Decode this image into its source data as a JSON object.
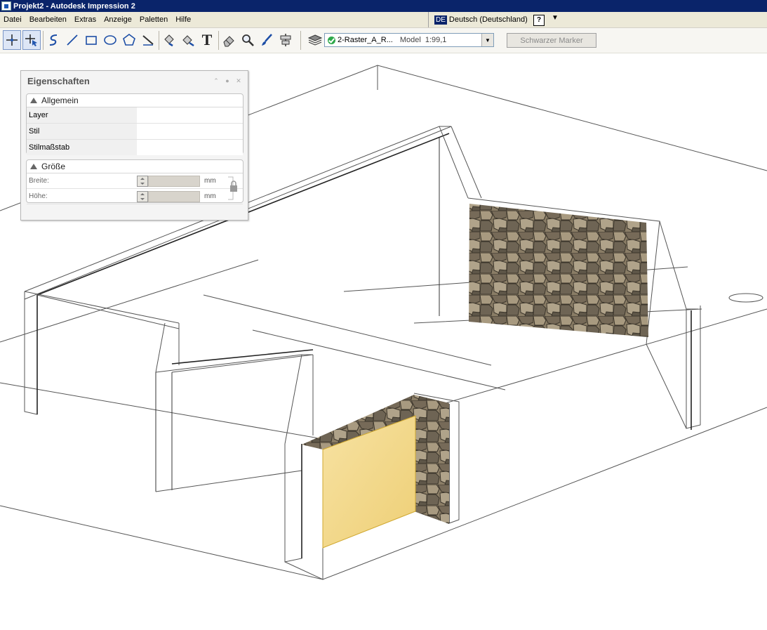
{
  "window": {
    "title": "Projekt2 - Autodesk Impression 2"
  },
  "menu": {
    "items": [
      "Datei",
      "Bearbeiten",
      "Extras",
      "Anzeige",
      "Paletten",
      "Hilfe"
    ],
    "language_flag": "DE",
    "language_label": "Deutsch (Deutschland)",
    "help_glyph": "?"
  },
  "toolbar": {
    "tools": [
      "select-pointer-icon",
      "select-edit-icon",
      "curve-icon",
      "line-icon",
      "rectangle-icon",
      "ellipse-icon",
      "polygon-icon",
      "ruler-icon",
      "fill-icon",
      "fill-edit-icon",
      "text-icon",
      "eraser-icon",
      "zoom-icon",
      "brush-icon",
      "align-icon",
      "layers-icon"
    ],
    "text_tool_glyph": "T",
    "layer_name": "2-Raster_A_R...",
    "layer_model": "Model",
    "layer_scale": "1:99,1",
    "marker_label": "Schwarzer Marker"
  },
  "properties": {
    "title": "Eigenschaften",
    "general": {
      "header": "Allgemein",
      "rows": [
        {
          "label": "Layer"
        },
        {
          "label": "Stil"
        },
        {
          "label": "Stilmaßstab"
        }
      ]
    },
    "size": {
      "header": "Größe",
      "width_label": "Breite:",
      "height_label": "Höhe:",
      "unit": "mm"
    }
  },
  "colors": {
    "titlebar": "#0a246a",
    "menubar": "#ece9d8",
    "stone_base": "#8a7d66",
    "door_fill": "#f2d88a"
  }
}
